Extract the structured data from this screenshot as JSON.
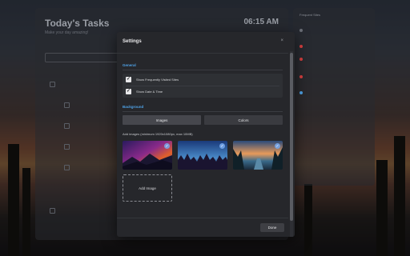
{
  "tasks": {
    "title": "Today's Tasks",
    "subtitle": "Make your day amazing!",
    "time": "06:15 AM"
  },
  "side": {
    "title": "Frequent Sites"
  },
  "settings": {
    "title": "Settings",
    "close_icon": "close-icon",
    "general_label": "General",
    "options": [
      {
        "label": "Show Frequently Visited Sites",
        "checked": true
      },
      {
        "label": "Show Date & Time",
        "checked": true
      }
    ],
    "background_label": "Background",
    "tabs": [
      {
        "label": "Images",
        "active": true
      },
      {
        "label": "Colors",
        "active": false
      }
    ],
    "add_images_label": "Add images (minimum 1920x1080px, max 10MB)",
    "add_image_button": "Add Image",
    "done_button": "Done"
  },
  "colors": {
    "accent": "#4fa3e8",
    "modal_bg": "#26272b"
  }
}
